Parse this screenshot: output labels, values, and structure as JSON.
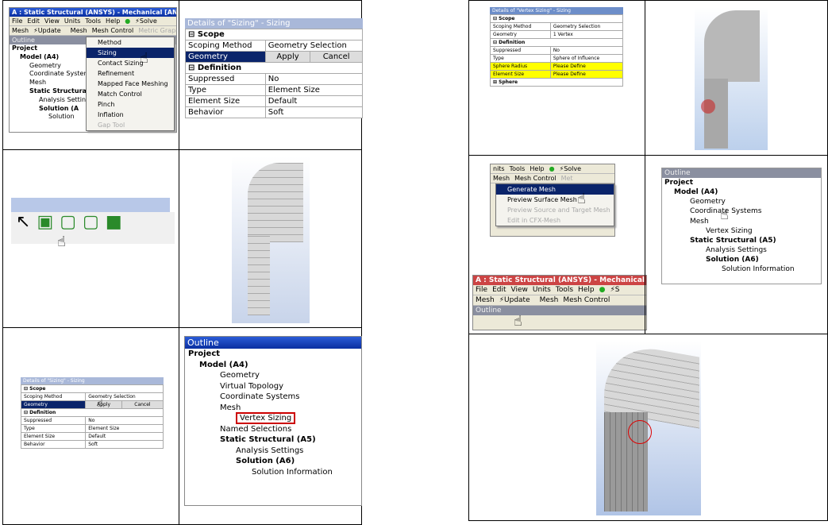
{
  "cell1": {
    "window_title": "A : Static Structural (ANSYS) - Mechanical [ANSYS Multiphysics]",
    "menubar": [
      "File",
      "Edit",
      "View",
      "Units",
      "Tools",
      "Help"
    ],
    "solve": "Solve",
    "toolbar": [
      "Mesh",
      "Update",
      "Mesh",
      "Mesh Control",
      "Metric Graph"
    ],
    "outline": "Outline",
    "tree": [
      "Project",
      "Model (A4)",
      "Geometry",
      "Coordinate System",
      "Mesh",
      "Static Structural",
      "Analysis Settings",
      "Solution (A",
      "Solution"
    ],
    "menu": [
      "Method",
      "Sizing",
      "Contact Sizing",
      "Refinement",
      "Mapped Face Meshing",
      "Match Control",
      "Pinch",
      "Inflation",
      "Gap Tool"
    ]
  },
  "cell2": {
    "header": "Details of \"Sizing\" - Sizing",
    "scope": "Scope",
    "scoping_method_label": "Scoping Method",
    "scoping_method": "Geometry Selection",
    "geometry_label": "Geometry",
    "apply": "Apply",
    "cancel": "Cancel",
    "definition": "Definition",
    "rows": [
      [
        "Suppressed",
        "No"
      ],
      [
        "Type",
        "Element Size"
      ],
      [
        "Element Size",
        "Default"
      ],
      [
        "Behavior",
        "Soft"
      ]
    ]
  },
  "cell6": {
    "outline": "Outline",
    "tree": [
      "Project",
      "Model (A4)",
      "Geometry",
      "Virtual Topology",
      "Coordinate Systems",
      "Mesh",
      "Vertex Sizing",
      "Named Selections",
      "Static Structural (A5)",
      "Analysis Settings",
      "Solution (A6)",
      "Solution Information"
    ]
  },
  "right1": {
    "header": "Details of \"Vertex Sizing\" - Sizing",
    "scope": "Scope",
    "rows1": [
      [
        "Scoping Method",
        "Geometry Selection"
      ],
      [
        "Geometry",
        "1 Vertex"
      ]
    ],
    "definition": "Definition",
    "rows2": [
      [
        "Suppressed",
        "No"
      ],
      [
        "Type",
        "Sphere of Influence"
      ]
    ],
    "yellow": [
      [
        "Sphere Radius",
        "Please Define"
      ],
      [
        "Element Size",
        "Please Define"
      ]
    ],
    "sphere": "Sphere"
  },
  "right3": {
    "menubar": [
      "nits",
      "Tools",
      "Help"
    ],
    "solve": "Solve",
    "toolbar": [
      "Mesh",
      "Mesh Control",
      "Met"
    ],
    "menu": [
      "Generate Mesh",
      "Preview Surface Mesh",
      "Preview Source and Target Mesh",
      "Edit in CFX-Mesh"
    ],
    "window_title": "A : Static Structural (ANSYS) - Mechanical [AN",
    "menubar2": [
      "File",
      "Edit",
      "View",
      "Units",
      "Tools",
      "Help"
    ],
    "solve2": "S",
    "toolbar2": [
      "Mesh",
      "Update",
      "Mesh",
      "Mesh Control"
    ],
    "outline": "Outline"
  },
  "right4": {
    "outline": "Outline",
    "tree": [
      "Project",
      "Model (A4)",
      "Geometry",
      "Coordinate Systems",
      "Mesh",
      "Vertex Sizing",
      "Static Structural (A5)",
      "Analysis Settings",
      "Solution (A6)",
      "Solution Information"
    ]
  }
}
